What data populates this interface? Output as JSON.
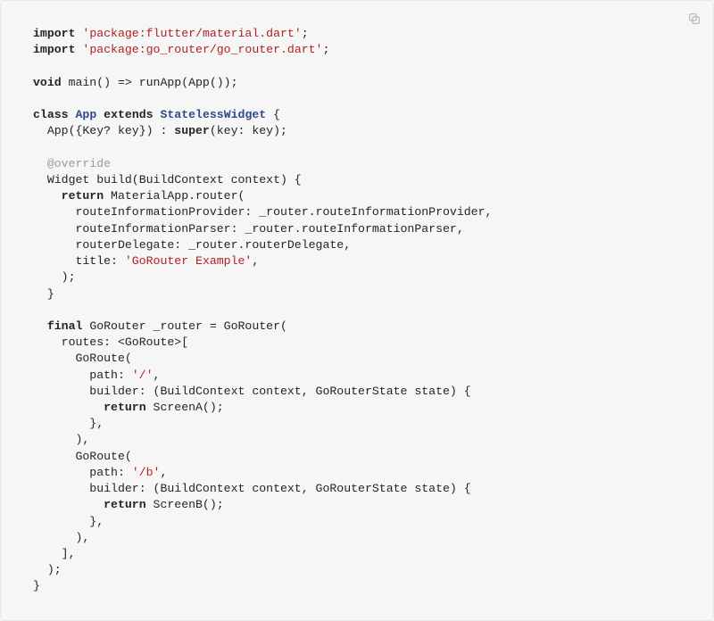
{
  "code": {
    "kw_import1": "import",
    "str_pkg1": "'package:flutter/material.dart'",
    "semi1": ";",
    "kw_import2": "import",
    "str_pkg2": "'package:go_router/go_router.dart'",
    "semi2": ";",
    "kw_void": "void",
    "main_rest": " main() => runApp(App());",
    "kw_class": "class",
    "sp": " ",
    "type_app": "App",
    "kw_extends": " extends ",
    "type_sw": "StatelessWidget",
    "brace_open": " {",
    "ctor": "  App({Key? key}) : ",
    "kw_super": "super",
    "ctor_rest": "(key: key);",
    "ann_override": "  @override",
    "build_sig": "  Widget build(BuildContext context) {",
    "kw_return1": "return",
    "ret1_rest": " MaterialApp.router(",
    "l_rip": "      routeInformationProvider: _router.routeInformationProvider,",
    "l_ripar": "      routeInformationParser: _router.routeInformationParser,",
    "l_rd": "      routerDelegate: _router.routerDelegate,",
    "l_title_pre": "      title: ",
    "str_title": "'GoRouter Example'",
    "l_title_post": ",",
    "close_paren1": "    );",
    "close_brace1": "  }",
    "kw_final": "final",
    "router_rest": " GoRouter _router = GoRouter(",
    "routes_open": "    routes: <GoRoute>[",
    "gr1_open": "      GoRoute(",
    "gr1_path_pre": "        path: ",
    "str_path1": "'/'",
    "gr1_path_post": ",",
    "gr1_builder": "        builder: (BuildContext context, GoRouterState state) {",
    "kw_return2": "return",
    "ret2_rest": " ScreenA();",
    "gr1_close_br": "        },",
    "gr1_close": "      ),",
    "gr2_open": "      GoRoute(",
    "gr2_path_pre": "        path: ",
    "str_path2": "'/b'",
    "gr2_path_post": ",",
    "gr2_builder": "        builder: (BuildContext context, GoRouterState state) {",
    "kw_return3": "return",
    "ret3_rest": " ScreenB();",
    "gr2_close_br": "        },",
    "gr2_close": "      ),",
    "routes_close": "    ],",
    "router_close": "  );",
    "class_close": "}"
  },
  "indent": {
    "i4": "    ",
    "i10": "          ",
    "i2": "  "
  }
}
